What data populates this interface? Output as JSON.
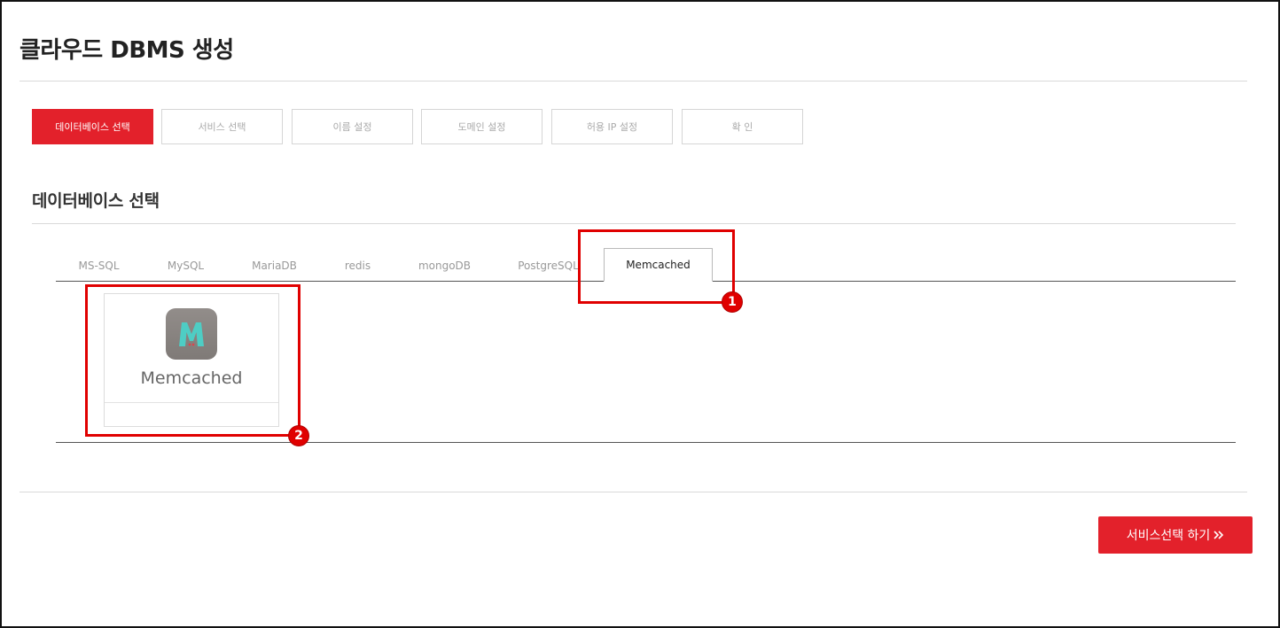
{
  "page": {
    "title": "클라우드 DBMS 생성"
  },
  "steps": [
    {
      "label": "데이터베이스 선택",
      "active": true
    },
    {
      "label": "서비스 선택",
      "active": false
    },
    {
      "label": "이름 설정",
      "active": false
    },
    {
      "label": "도메인 설정",
      "active": false
    },
    {
      "label": "허용 IP 설정",
      "active": false
    },
    {
      "label": "확  인",
      "active": false
    }
  ],
  "section": {
    "title": "데이터베이스 선택"
  },
  "tabs": [
    {
      "label": "MS-SQL"
    },
    {
      "label": "MySQL"
    },
    {
      "label": "MariaDB"
    },
    {
      "label": "redis"
    },
    {
      "label": "mongoDB"
    },
    {
      "label": "PostgreSQL"
    },
    {
      "label": "Memcached",
      "active": true
    }
  ],
  "card": {
    "name": "Memcached",
    "logo_letter": "M",
    "logo_icon": "memcached-logo-icon"
  },
  "next_button": {
    "label": "서비스선택 하기",
    "icon": "double-chevron-right-icon"
  },
  "annotations": [
    {
      "label": "1"
    },
    {
      "label": "2"
    }
  ],
  "colors": {
    "accent": "#e3212b",
    "highlight": "#e00000",
    "logo_bg": "#8a8582",
    "logo_letter": "#4ecdc4"
  }
}
